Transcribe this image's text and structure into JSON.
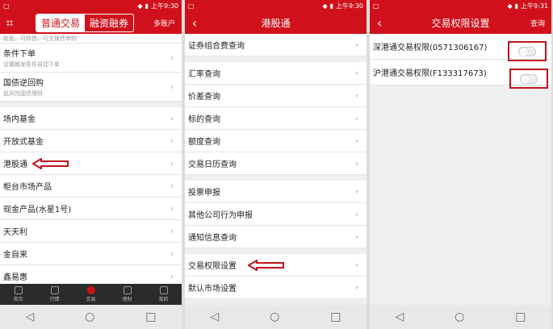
{
  "status": {
    "s1_time": "上午9:30",
    "s2_time": "上午9:30",
    "s3_time": "上午9:31"
  },
  "screen1": {
    "tab_normal": "普通交易",
    "tab_margin": "融资融券",
    "multi_account": "多账户",
    "truncated_text": "新股、可转债、可交换债申购",
    "rows": [
      {
        "label": "条件下单",
        "sub": "设置触发条件自动下单"
      },
      {
        "label": "国债逆回购",
        "sub": "低风险国债理财"
      }
    ],
    "rows2": [
      "场内基金",
      "开放式基金",
      "港股通",
      "柜台市场产品",
      "现金产品(水星1号)",
      "天天利",
      "金自来",
      "鑫易惠"
    ],
    "tabs": [
      "首页",
      "行情",
      "交易",
      "理财",
      "我的"
    ]
  },
  "screen2": {
    "title": "港股通",
    "group1": [
      "证券组合费查询"
    ],
    "group2": [
      "汇率查询",
      "价差查询",
      "标的查询",
      "额度查询",
      "交易日历查询"
    ],
    "group3": [
      "投票申报",
      "其他公司行为申报",
      "通知信息查询"
    ],
    "group4": [
      "交易权限设置",
      "默认市场设置"
    ]
  },
  "screen3": {
    "title": "交易权限设置",
    "action": "查询",
    "rows": [
      {
        "label": "深港通交易权限(0571306167)"
      },
      {
        "label": "沪港通交易权限(F133317673)"
      }
    ]
  },
  "colors": {
    "brand": "#d0111b"
  }
}
